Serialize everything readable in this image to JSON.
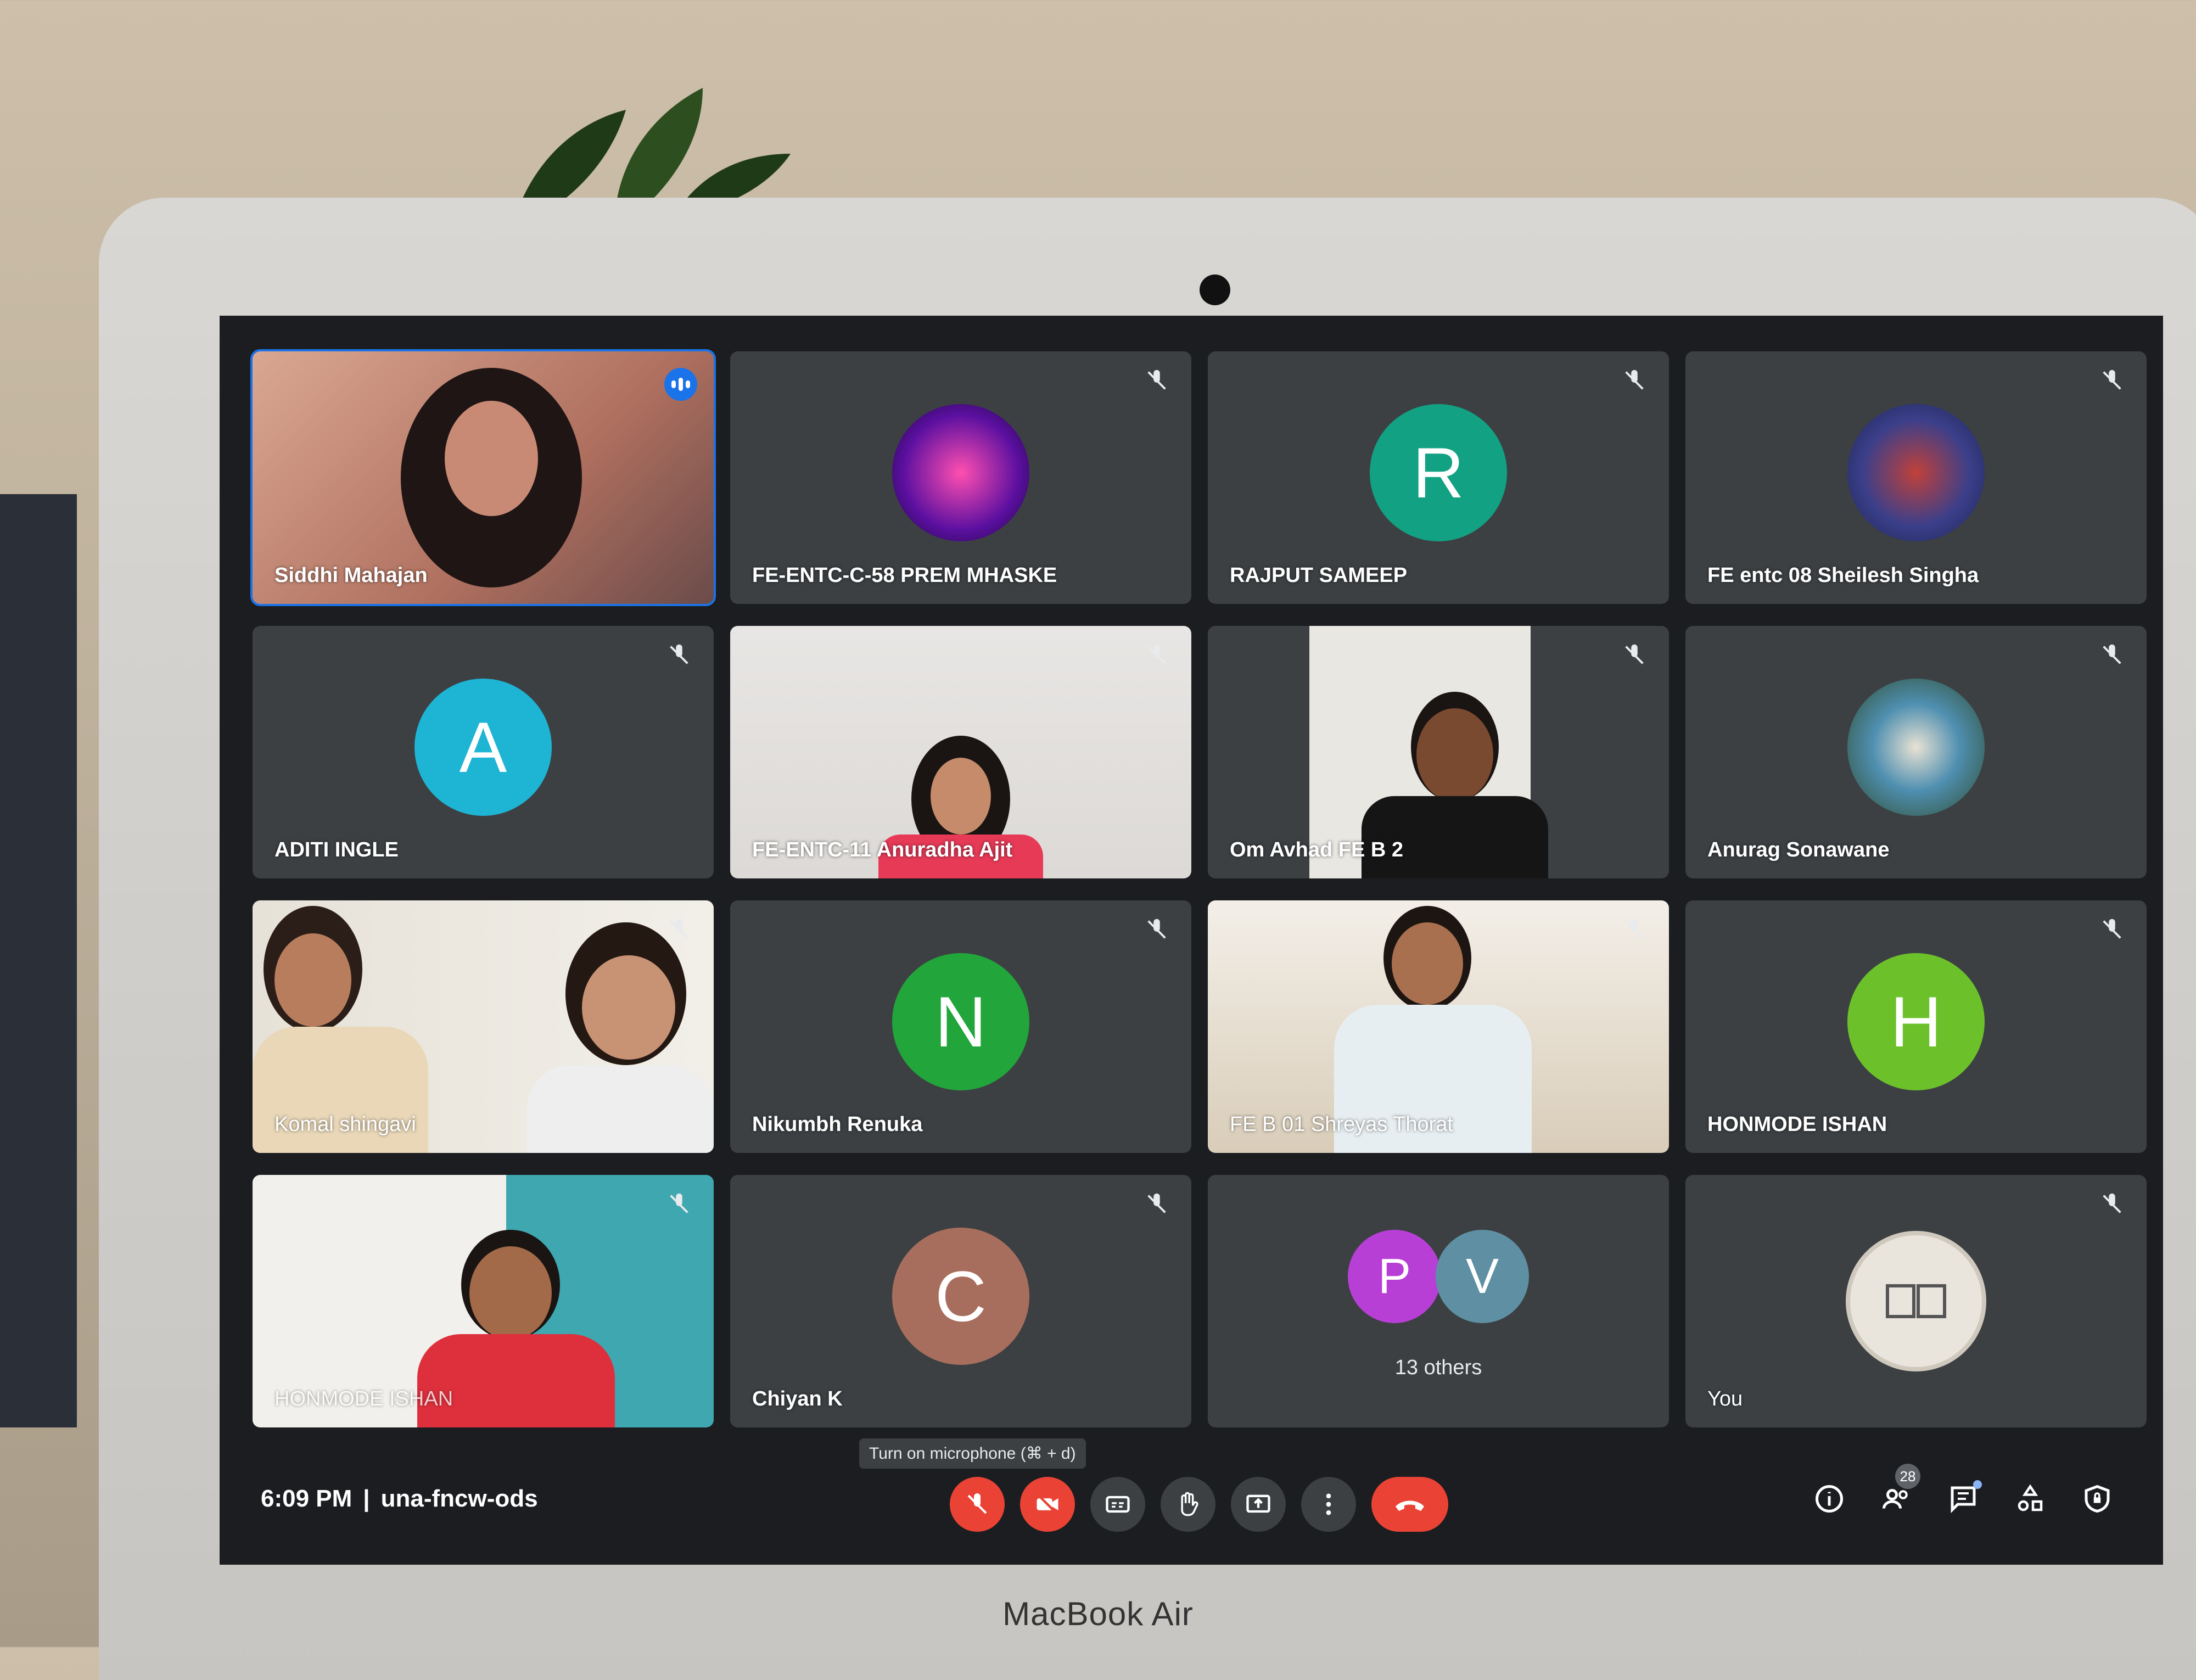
{
  "device": {
    "brand_label": "MacBook Air"
  },
  "tiles": [
    {
      "name": "Siddhi Mahajan",
      "type": "video",
      "active": true,
      "speaking": true
    },
    {
      "name": "FE-ENTC-C-58 PREM MHASKE",
      "type": "profile",
      "muted": true
    },
    {
      "name": "RAJPUT SAMEEP",
      "type": "letter",
      "initial": "R",
      "color": "#12a182",
      "muted": true
    },
    {
      "name": "FE entc 08 Sheilesh Singha",
      "type": "profile",
      "muted": true
    },
    {
      "name": "ADITI INGLE",
      "type": "letter",
      "initial": "A",
      "color": "#1eb4d4",
      "muted": true
    },
    {
      "name": "FE-ENTC-11 Anuradha Ajit",
      "type": "video",
      "muted": true
    },
    {
      "name": "Om Avhad FE B 2",
      "type": "video",
      "muted": true
    },
    {
      "name": "Anurag Sonawane",
      "type": "profile",
      "muted": true
    },
    {
      "name": "Komal shingavi",
      "type": "video",
      "muted": true
    },
    {
      "name": "Nikumbh Renuka",
      "type": "letter",
      "initial": "N",
      "color": "#22a53a",
      "muted": true
    },
    {
      "name": "FE B 01 Shreyas Thorat",
      "type": "video",
      "muted": true
    },
    {
      "name": "HONMODE ISHAN",
      "type": "letter",
      "initial": "H",
      "color": "#6cc12b",
      "muted": true
    },
    {
      "name": "HONMODE ISHAN",
      "type": "video",
      "muted": true
    },
    {
      "name": "Chiyan K",
      "type": "letter",
      "initial": "C",
      "color": "#a86e5d",
      "muted": true
    },
    {
      "name": "13 others",
      "type": "others",
      "initials": [
        "P",
        "V"
      ],
      "colors": [
        "#b83fd6",
        "#5e8fa3"
      ]
    },
    {
      "name": "You",
      "type": "logo",
      "muted": true
    }
  ],
  "bottom_bar": {
    "time": "6:09 PM",
    "separator": "|",
    "meeting_code": "una-fncw-ods",
    "tooltip": "Turn on microphone (⌘ + d)",
    "controls": [
      "mic-off",
      "camera-off",
      "captions",
      "raise-hand",
      "present",
      "more-options",
      "leave-call"
    ],
    "participant_count": "28"
  }
}
